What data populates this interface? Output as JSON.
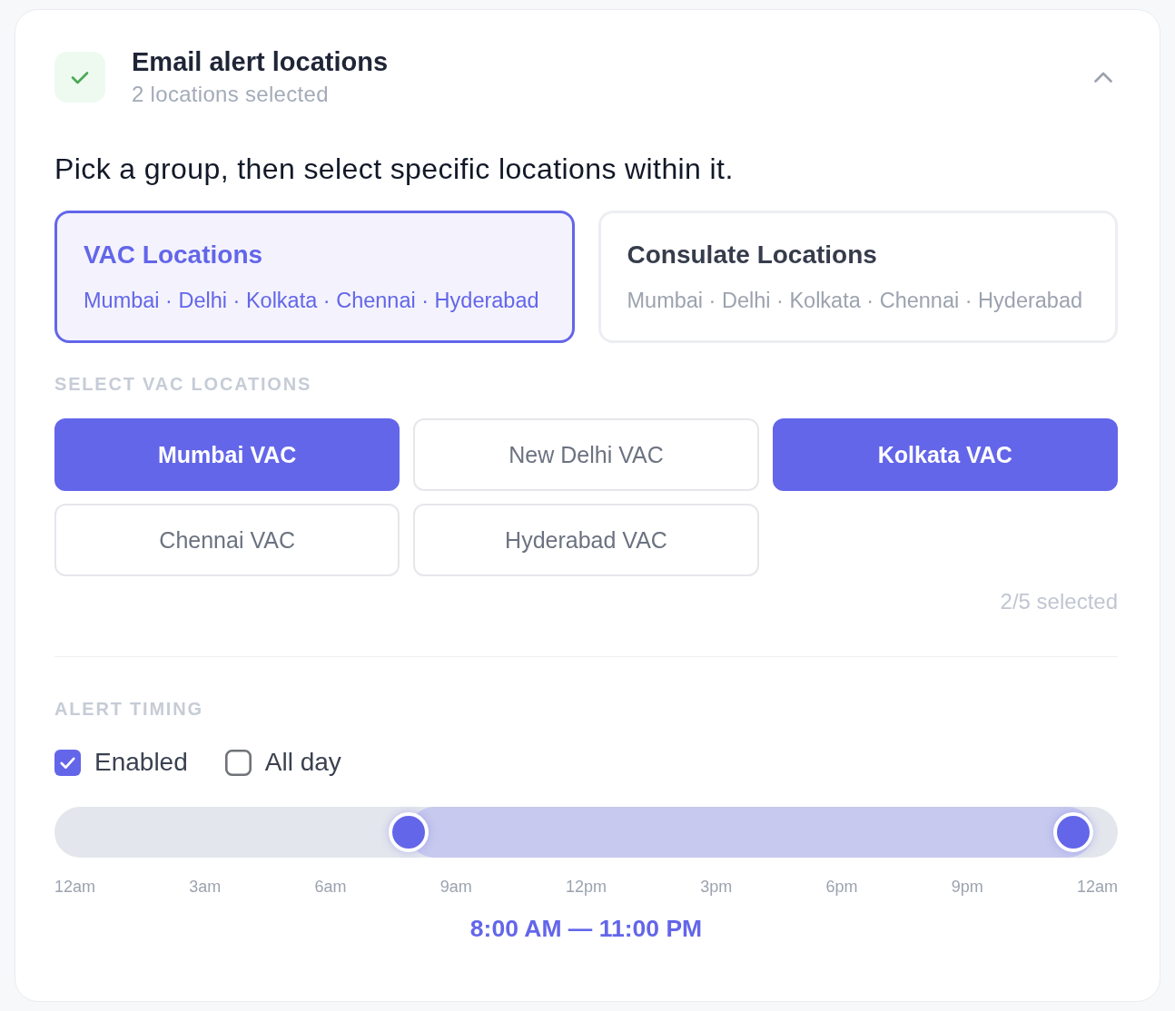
{
  "header": {
    "title": "Email alert locations",
    "subtitle": "2 locations selected",
    "expanded": true
  },
  "instruction": "Pick a group, then select specific locations within it.",
  "groups": [
    {
      "title": "VAC Locations",
      "locations": "Mumbai · Delhi · Kolkata · Chennai · Hyderabad",
      "selected": true
    },
    {
      "title": "Consulate Locations",
      "locations": "Mumbai · Delhi · Kolkata · Chennai · Hyderabad",
      "selected": false
    }
  ],
  "locations": {
    "heading": "SELECT VAC LOCATIONS",
    "options": [
      {
        "label": "Mumbai VAC",
        "selected": true
      },
      {
        "label": "New Delhi VAC",
        "selected": false
      },
      {
        "label": "Kolkata VAC",
        "selected": true
      },
      {
        "label": "Chennai VAC",
        "selected": false
      },
      {
        "label": "Hyderabad VAC",
        "selected": false
      }
    ],
    "count": "2/5 selected"
  },
  "timing": {
    "heading": "ALERT TIMING",
    "checkboxes": [
      {
        "label": "Enabled",
        "checked": true
      },
      {
        "label": "All day",
        "checked": false
      }
    ],
    "slider": {
      "thumbs": [
        {
          "level": 0.3333
        },
        {
          "level": 0.9583
        }
      ]
    },
    "ticks": [
      "12am",
      "3am",
      "6am",
      "9am",
      "12pm",
      "3pm",
      "6pm",
      "9pm",
      "12am"
    ],
    "range": "8:00 AM — 11:00 PM"
  }
}
